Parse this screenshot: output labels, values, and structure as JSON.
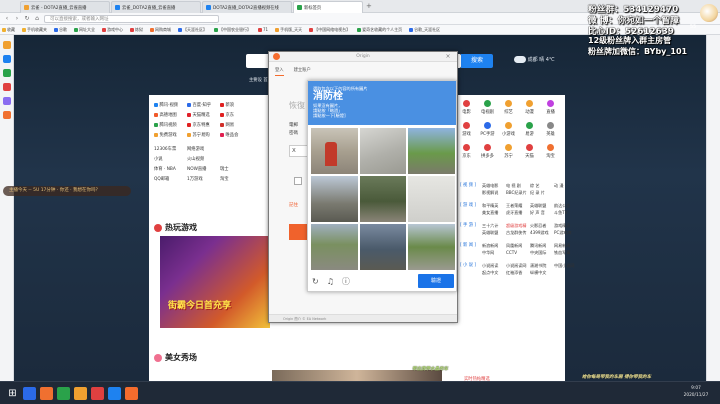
{
  "tabs": [
    {
      "label": "云雀 - DOTA2直播_云雀直播",
      "color": "#f0a030"
    },
    {
      "label": "云雀_DOTA2直播_云雀直播",
      "color": "#1e82f0"
    },
    {
      "label": "DOTA2直播_DOTA2直播视频在线",
      "color": "#1e82f0"
    },
    {
      "label": "新标签页",
      "color": "#2aa24a",
      "active": true
    }
  ],
  "address": {
    "placeholder": "可以直接搜索，或者输入网址"
  },
  "bookmarks": [
    "收藏",
    "手机收藏夹",
    "谷歌",
    "网址大全",
    "游戏中心",
    "炼狱",
    "网购商城",
    "【天涯社区】",
    "【中国农业银行】",
    "71",
    "手机版_天天",
    "【中国网络电视台】",
    "爱奇艺收藏的个人主页",
    "谷歌_天涯社区"
  ],
  "fan_overlay": {
    "line1": "粉丝群：534129470",
    "line2": "微 博：你宛如一个智障",
    "line3": "比心ID：52612639",
    "line4": "12级粉丝牌入群主房管",
    "line5": "粉丝牌加微信：BYby_101",
    "bottom_green": "带出我带水晶的车",
    "bottom_right": "给你每局带我的车厢 得你带我的车",
    "side_number": "55"
  },
  "danmu": "主播今天 -- 5U 17分钟  · 你还 ·  我想在你吗？",
  "page": {
    "search_btn": "搜索",
    "weather": "成都 晴 4℃",
    "homepage_links": "主要设 首页 · 搜索  城市",
    "hot_games_title": "热玩游戏",
    "beauty_title": "美女秀场",
    "hot_game_banner": "街霸今日首充享",
    "bottom_link": "实时热帖精选"
  },
  "sites": [
    {
      "n": "腾讯·视频",
      "c": "#1e82f0"
    },
    {
      "n": "百度·知乎",
      "c": "#2b6ae8"
    },
    {
      "n": "新浪",
      "c": "#e02020"
    },
    {
      "n": "高德地图",
      "c": "#f05a2a"
    },
    {
      "n": "天猫精选",
      "c": "#e0202a"
    },
    {
      "n": "京东",
      "c": "#e02020"
    },
    {
      "n": "腾讯视频",
      "c": "#2aa24a"
    },
    {
      "n": "京东特惠",
      "c": "#e02020"
    },
    {
      "n": "网易",
      "c": "#d0302a"
    },
    {
      "n": "免费游戏",
      "c": "#f0a030"
    },
    {
      "n": "苏宁易购",
      "c": "#f0a030"
    },
    {
      "n": "唯品会",
      "c": "#e02050"
    }
  ],
  "site_text_rows": [
    [
      "12306车票",
      "网络游戏"
    ],
    [
      "小说",
      "火山视频"
    ],
    [
      "体育 · NBA",
      "NOW直播",
      "瑞士"
    ],
    [
      "QQ邮箱",
      "1万游戏",
      "淘宝"
    ]
  ],
  "app_icons": [
    {
      "n": "电影",
      "c": "#e04040"
    },
    {
      "n": "电视剧",
      "c": "#2aa24a"
    },
    {
      "n": "综艺",
      "c": "#f0a030"
    },
    {
      "n": "动漫",
      "c": "#f0a030"
    },
    {
      "n": "直播",
      "c": "#c040e0"
    },
    {
      "n": "游戏",
      "c": "#e04040"
    },
    {
      "n": "PC手游",
      "c": "#2b6ae8"
    },
    {
      "n": "小游戏",
      "c": "#f0a030"
    },
    {
      "n": "易游",
      "c": "#2aa24a"
    },
    {
      "n": "英雄",
      "c": "#888"
    },
    {
      "n": "京东",
      "c": "#e04040"
    },
    {
      "n": "拼多多",
      "c": "#e04040"
    },
    {
      "n": "苏宁",
      "c": "#f0a030"
    },
    {
      "n": "天猫",
      "c": "#e04040"
    },
    {
      "n": "淘宝",
      "c": "#f07030"
    }
  ],
  "categories": [
    {
      "tag": "[ 视 频 ]",
      "items": [
        "英雄电影",
        "电 视 剧",
        "综 艺",
        "动 漫",
        "影视解说",
        "BBC纪录片",
        "纪 录 片"
      ]
    },
    {
      "tag": "[ 游 戏 ]",
      "items": [
        "和平精英",
        "王者荣耀",
        "英雄联盟",
        "韵达公交",
        "美女直播",
        "虎牙直播",
        "好 声 音",
        "斗鱼TV"
      ]
    },
    {
      "tag": "[ 手 游 ]",
      "items": [
        "三十六计",
        "超级游戏精",
        "火影忍者",
        "游戏精灵",
        "英雄联盟",
        "古龙群侠传",
        "4399游戏",
        "PC游戏库"
      ]
    },
    {
      "tag": "[ 新 闻 ]",
      "items": [
        "新浪新闻",
        "凤凰新闻",
        "腾讯新闻",
        "网易新闻",
        "中华网",
        "CCTV",
        "中央国际",
        "铁血军事"
      ]
    },
    {
      "tag": "[ 小 说 ]",
      "items": [
        "小说阅读",
        "小说阅读网",
        "潇湘书院",
        "中国小说网",
        "起点中文",
        "红袖添香",
        "纵横中文"
      ]
    }
  ],
  "origin": {
    "title": "Origin",
    "tab_login": "登入",
    "tab_register": "建立账户",
    "heading": "恢復",
    "label1": "電郵",
    "label2": "密碼",
    "field_mark": "X",
    "remember": "記住",
    "footer": "Origin 簡介  ©  EA Network"
  },
  "captcha": {
    "line1": "選取包含以下內容的所有圖片",
    "keyword": "消防栓",
    "line3": "如果沒有圖片，",
    "line4": "請點按「略過」",
    "line5": "請點按一下[驗證]",
    "verify": "驗證"
  },
  "taskbar": {
    "time": "9:07",
    "date": "2020/11/27"
  }
}
